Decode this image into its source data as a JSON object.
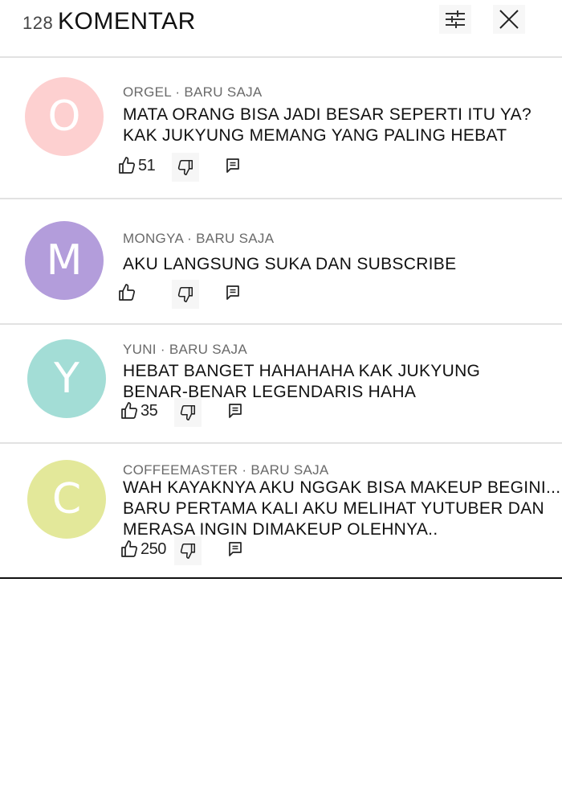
{
  "header": {
    "count": "128",
    "title": "KOMENTAR"
  },
  "comments": [
    {
      "initial": "O",
      "color": "#fdd0d0",
      "author": "ORGEL · BARU SAJA",
      "lines": [
        "MATA ORANG BISA JADI BESAR SEPERTI ITU YA?",
        "KAK JUKYUNG MEMANG YANG PALING HEBAT"
      ],
      "likes": "51"
    },
    {
      "initial": "M",
      "color": "#b39ddb",
      "author": "MONGYA · BARU SAJA",
      "lines": [
        "AKU LANGSUNG SUKA DAN SUBSCRIBE"
      ],
      "likes": ""
    },
    {
      "initial": "Y",
      "color": "#a3ddd6",
      "author": "YUNI · BARU SAJA",
      "lines": [
        "HEBAT BANGET HAHAHAHA KAK JUKYUNG",
        "BENAR-BENAR LEGENDARIS HAHA"
      ],
      "likes": "35"
    },
    {
      "initial": "C",
      "color": "#e3e89a",
      "author": "COFFEEMASTER · BARU SAJA",
      "lines": [
        "WAH KAYAKNYA AKU NGGAK BISA MAKEUP BEGINI...",
        "BARU PERTAMA KALI AKU MELIHAT YUTUBER DAN",
        "MERASA INGIN DIMAKEUP OLEHNYA.."
      ],
      "likes": "250"
    }
  ]
}
